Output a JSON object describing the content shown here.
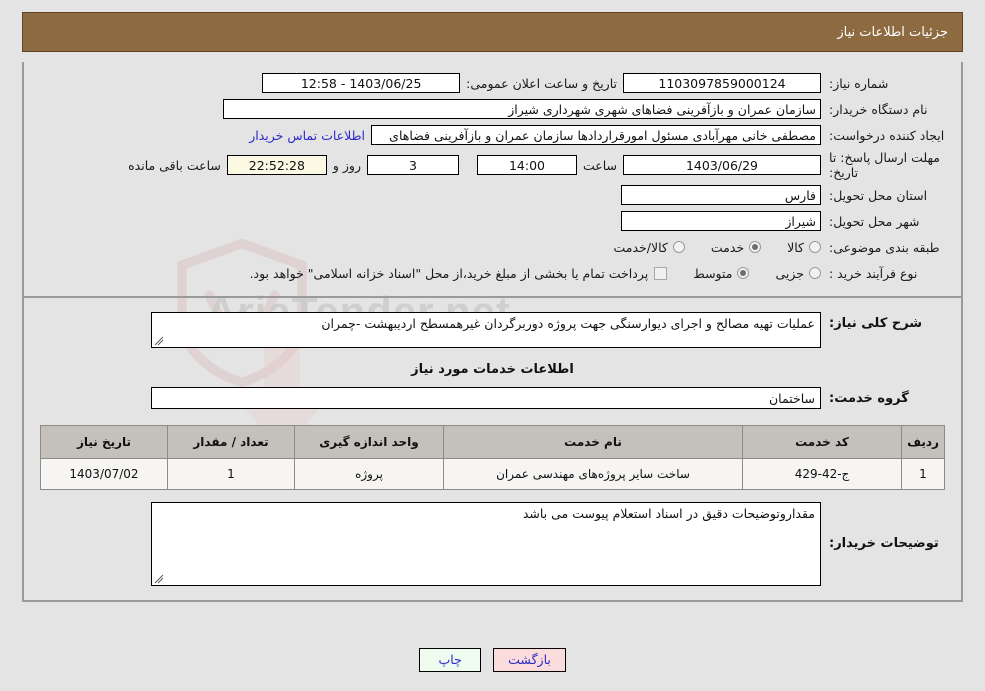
{
  "header": {
    "title": "جزئیات اطلاعات نیاز",
    "bg_color": "#8d6a40"
  },
  "watermark": {
    "text": "AriaTender.net"
  },
  "general": {
    "need_number_label": "شماره نیاز:",
    "need_number_value": "1103097859000124",
    "public_announce_label": "تاریخ و ساعت اعلان عمومی:",
    "public_announce_value": "1403/06/25 - 12:58",
    "buyer_org_label": "نام دستگاه خریدار:",
    "buyer_org_value": "سازمان عمران و بازآفرینی فضاهای شهری شهرداری شیراز",
    "creator_label": "ایجاد کننده درخواست:",
    "creator_value": "مصطفی خانی مهرآبادی مسئول امورقراردادها سازمان عمران و بازآفرینی فضاهای",
    "contact_link": "اطلاعات تماس خریدار",
    "deadline_label": "مهلت ارسال پاسخ: تا تاریخ:",
    "deadline_date": "1403/06/29",
    "deadline_hour_label": "ساعت",
    "deadline_hour": "14:00",
    "remaining_days": "3",
    "remaining_days_label": "روز و",
    "remaining_time": "22:52:28",
    "remaining_time_label": "ساعت باقی مانده",
    "province_label": "استان محل تحویل:",
    "province_value": "فارس",
    "city_label": "شهر محل تحویل:",
    "city_value": "شیراز",
    "classification_label": "طبقه بندی موضوعی:",
    "classification_options": [
      {
        "label": "کالا",
        "selected": false
      },
      {
        "label": "خدمت",
        "selected": true
      },
      {
        "label": "کالا/خدمت",
        "selected": false
      }
    ],
    "process_type_label": "نوع فرآیند خرید :",
    "process_type_options": [
      {
        "label": "جزیی",
        "selected": false
      },
      {
        "label": "متوسط",
        "selected": true
      }
    ],
    "treasury_checkbox_checked": false,
    "treasury_note": "پرداخت تمام یا بخشی از مبلغ خرید،از محل \"اسناد خزانه اسلامی\" خواهد بود."
  },
  "need_description": {
    "label": "شرح کلی نیاز:",
    "value": "عملیات تهیه مصالح و اجرای دیوارسنگی جهت پروژه دوربرگردان غیرهمسطح اردیبهشت -چمران"
  },
  "services": {
    "heading": "اطلاعات خدمات مورد نیاز",
    "group_label": "گروه خدمت:",
    "group_value": "ساختمان",
    "columns": [
      "ردیف",
      "کد خدمت",
      "نام خدمت",
      "واحد اندازه گیری",
      "تعداد / مقدار",
      "تاریخ نیاز"
    ],
    "rows": [
      {
        "radif": "1",
        "code": "ج-42-429",
        "name": "ساخت سایر پروژه‌های مهندسی عمران",
        "unit": "پروژه",
        "quantity": "1",
        "need_date": "1403/07/02"
      }
    ]
  },
  "buyer_notes": {
    "label": "توضیحات خریدار:",
    "value": "مقداروتوضیحات دقیق در اسناد استعلام پیوست می باشد"
  },
  "footer": {
    "print_label": "چاپ",
    "back_label": "بازگشت"
  }
}
